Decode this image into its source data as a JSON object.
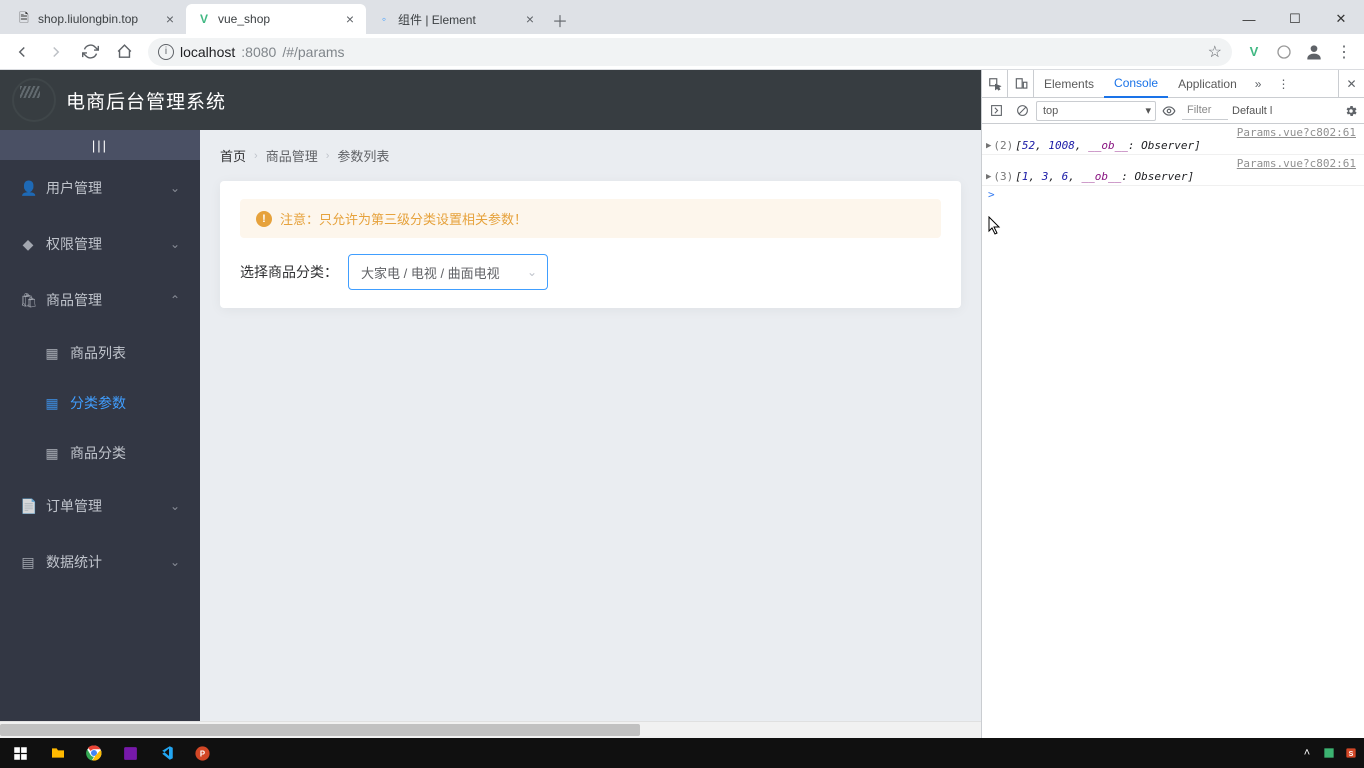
{
  "browser": {
    "tabs": [
      {
        "title": "shop.liulongbin.top",
        "favicon": "page"
      },
      {
        "title": "vue_shop",
        "favicon": "vue",
        "active": true
      },
      {
        "title": "组件 | Element",
        "favicon": "element"
      }
    ],
    "url_host": "localhost",
    "url_port": ":8080",
    "url_path": "/#/params"
  },
  "app": {
    "title": "电商后台管理系统",
    "collapse_label": "|||",
    "sidebar": [
      {
        "icon": "user",
        "label": "用户管理",
        "arrow": "down"
      },
      {
        "icon": "shield",
        "label": "权限管理",
        "arrow": "down"
      },
      {
        "icon": "bag",
        "label": "商品管理",
        "arrow": "up",
        "children": [
          {
            "label": "商品列表",
            "active": false
          },
          {
            "label": "分类参数",
            "active": true
          },
          {
            "label": "商品分类",
            "active": false
          }
        ]
      },
      {
        "icon": "doc",
        "label": "订单管理",
        "arrow": "down"
      },
      {
        "icon": "chart",
        "label": "数据统计",
        "arrow": "down"
      }
    ],
    "breadcrumb": {
      "home": "首页",
      "l2": "商品管理",
      "l3": "参数列表"
    },
    "alert": "注意：只允许为第三级分类设置相关参数！",
    "selector_label": "选择商品分类：",
    "cascader_value": "大家电 / 电视 / 曲面电视"
  },
  "devtools": {
    "tabs": {
      "elements": "Elements",
      "console": "Console",
      "application": "Application"
    },
    "context": "top",
    "filter_placeholder": "Filter",
    "level_label": "Default l",
    "logs": [
      {
        "src": "Params.vue?c802:61",
        "count": "(2)",
        "arr": "[52, 1008, __ob__: Observer]",
        "n1": "52",
        "n2": "1008"
      },
      {
        "src": "Params.vue?c802:61",
        "count": "(3)",
        "arr": "[1, 3, 6, __ob__: Observer]",
        "n1": "1",
        "n2": "3",
        "n3": "6"
      }
    ],
    "prompt": ">"
  }
}
